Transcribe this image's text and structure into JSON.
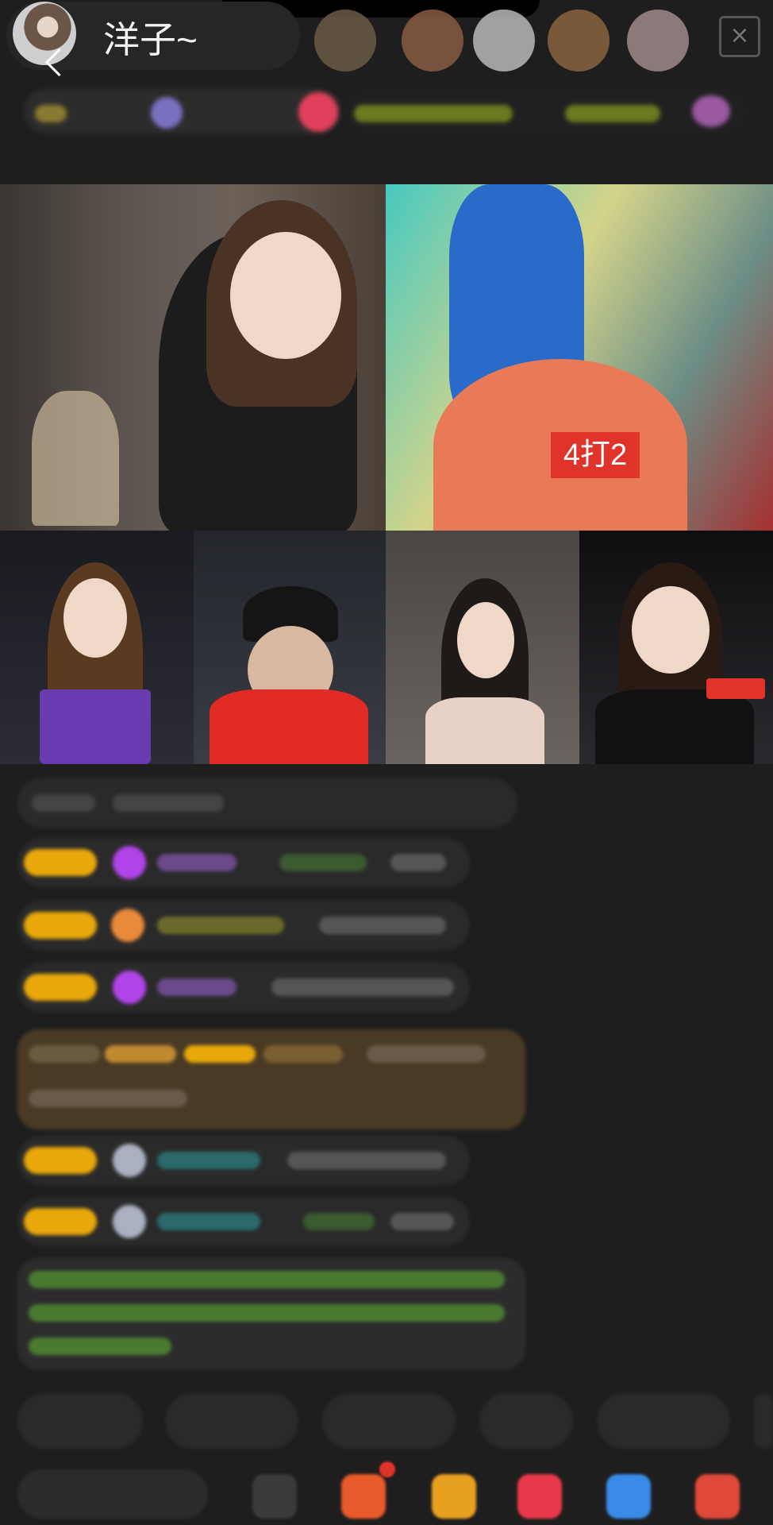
{
  "header": {
    "host_name": "洋子~",
    "close_label": "×"
  },
  "stream": {
    "score_tag": "4打2"
  },
  "colors": {
    "badge": "#e8a80c",
    "score_tag": "#e0332a",
    "chat_green": "#7bc24a"
  }
}
